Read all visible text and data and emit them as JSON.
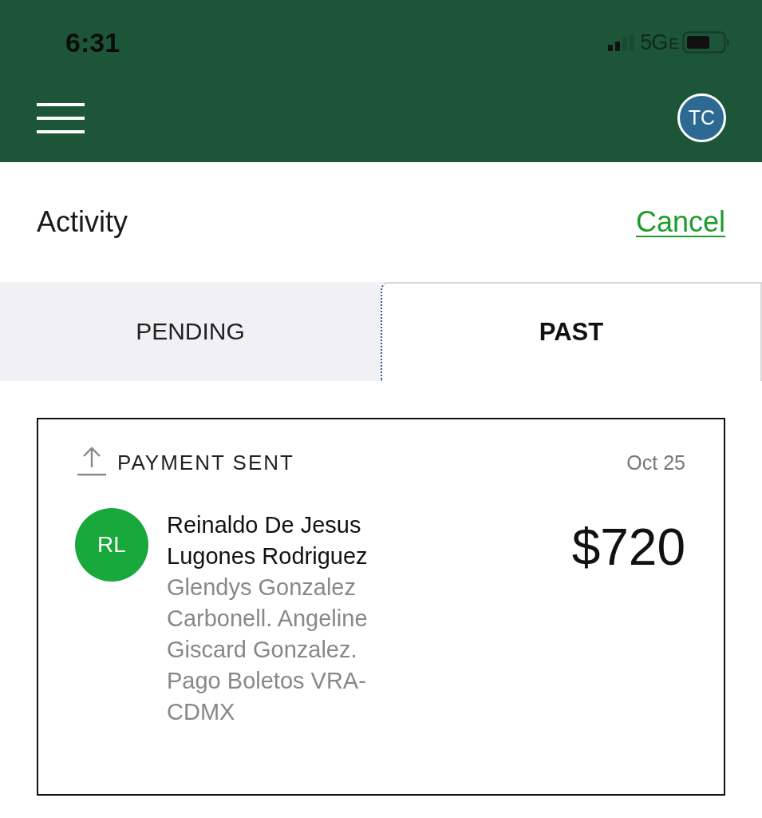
{
  "status_bar": {
    "time": "6:31",
    "network": "5G",
    "network_suffix": "E"
  },
  "header": {
    "avatar_initials": "TC"
  },
  "page": {
    "title": "Activity",
    "action": "Cancel"
  },
  "tabs": [
    {
      "label": "PENDING",
      "selected": false
    },
    {
      "label": "PAST",
      "selected": true
    }
  ],
  "activities": [
    {
      "kind": "sent",
      "type_label": "PAYMENT SENT",
      "date": "Oct 25",
      "avatar_initials": "RL",
      "color": "#19a83c",
      "name": "Reinaldo De Jesus Lugones Rodriguez",
      "note": "Glendys Gonzalez Carbonell. Angeline Giscard Gonzalez. Pago Boletos VRA-CDMX",
      "amount": "$720"
    }
  ]
}
